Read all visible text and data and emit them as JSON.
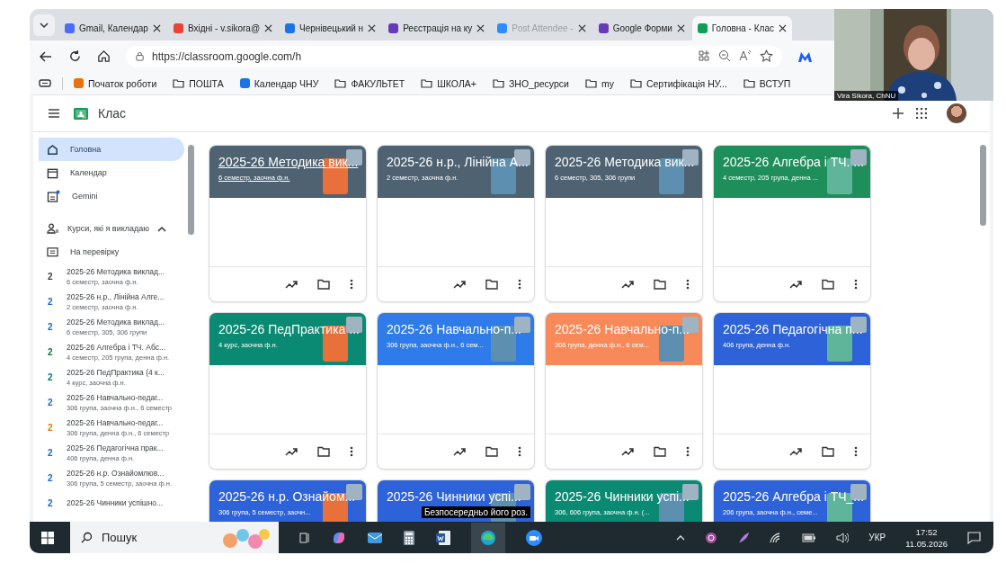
{
  "browser": {
    "tabs": [
      {
        "label": "Gmail, Календар",
        "color": "#4a6cf7",
        "selected": false,
        "disabled": false
      },
      {
        "label": "Вхідні - v.sikora@",
        "color": "#ea4335",
        "selected": false,
        "disabled": false
      },
      {
        "label": "Чернівецький н",
        "color": "#1a73e8",
        "selected": false,
        "disabled": false
      },
      {
        "label": "Реєстрація на ку",
        "color": "#673ab7",
        "selected": false,
        "disabled": false
      },
      {
        "label": "Post Attendee -",
        "color": "#2d8cff",
        "selected": false,
        "disabled": true
      },
      {
        "label": "Google Форми",
        "color": "#673ab7",
        "selected": false,
        "disabled": false
      },
      {
        "label": "Головна - Клас",
        "color": "#0f9d58",
        "selected": true,
        "disabled": false
      }
    ],
    "url": "https://classroom.google.com/h",
    "bookmarks": [
      {
        "label": "Початок роботи",
        "kind": "site",
        "color": "#e8710a"
      },
      {
        "label": "ПОШТА",
        "kind": "folder"
      },
      {
        "label": "Календар ЧНУ",
        "kind": "site",
        "color": "#1a73e8"
      },
      {
        "label": "ФАКУЛЬТЕТ",
        "kind": "folder"
      },
      {
        "label": "ШКОЛА+",
        "kind": "folder"
      },
      {
        "label": "ЗНО_ресурси",
        "kind": "folder"
      },
      {
        "label": "my",
        "kind": "folder"
      },
      {
        "label": "Сертифікація НУ...",
        "kind": "folder"
      },
      {
        "label": "ВСТУП",
        "kind": "folder"
      }
    ]
  },
  "webcam": {
    "kind": "picture",
    "caption": "Vira Sikora, ChNU"
  },
  "app": {
    "title": "Клас",
    "nav": [
      {
        "label": "Головна",
        "kind": "home",
        "selected": true
      },
      {
        "label": "Календар",
        "kind": "calendar",
        "selected": false
      },
      {
        "label": "Gemini",
        "kind": "gemini",
        "selected": false
      }
    ],
    "section": {
      "label": "Курси, які я викладаю",
      "expanded": true
    },
    "review": "На перевірку",
    "courses": [
      {
        "badge": "2",
        "color": "#3c4043",
        "title": "2025-26 Методика виклад...",
        "subtitle": "6 семестр, заочна ф.н."
      },
      {
        "badge": "2",
        "color": "#1967d2",
        "title": "2025-26 н.р., Лінійна Алге...",
        "subtitle": "2 семестр, заочна ф.н."
      },
      {
        "badge": "2",
        "color": "#1967d2",
        "title": "2025-26 Методика виклад...",
        "subtitle": "6 семестр, 305, 306 групи"
      },
      {
        "badge": "2",
        "color": "#137333",
        "title": "2025-26 Алгебра і ТЧ. Абс...",
        "subtitle": "4 семестр, 205 група, денна ф.н."
      },
      {
        "badge": "2",
        "color": "#00796b",
        "title": "2025-26 ПедПрактика (4 к...",
        "subtitle": "4 курс, заочна ф.н."
      },
      {
        "badge": "2",
        "color": "#1967d2",
        "title": "2025-26 Навчально-педаг...",
        "subtitle": "306 група, заочна ф.н., 6 семестр"
      },
      {
        "badge": "2",
        "color": "#e37400",
        "title": "2025-26 Навчально-педаг...",
        "subtitle": "306 група, денна ф.н., 6 семестр"
      },
      {
        "badge": "2",
        "color": "#1967d2",
        "title": "2025-26 Педагогічна прак...",
        "subtitle": "406 група, денна ф.н."
      },
      {
        "badge": "2",
        "color": "#1967d2",
        "title": "2025-26 н.р. Ознайомлюв...",
        "subtitle": "306 група, 5 семестр, заочна ф.н."
      },
      {
        "badge": "2",
        "color": "#1967d2",
        "title": "2025-26 Чинники успішно..."
      }
    ],
    "cards": [
      {
        "title": "2025-26 Методика вик...",
        "subtitle": "6 семестр, заочна ф.н.",
        "color": "#4f6272",
        "hovered": true
      },
      {
        "title": "2025-26 н.р., Лінійна А...",
        "subtitle": "2 семестр, заочна ф.н.",
        "color": "#4f6272",
        "hovered": false
      },
      {
        "title": "2025-26 Методика вик...",
        "subtitle": "6 семестр, 305, 306 групи",
        "color": "#4f6272",
        "hovered": false
      },
      {
        "title": "2025-26 Алгебра і ТЧ. ...",
        "subtitle": "4 семестр, 205 група, денна ...",
        "color": "#1e8e5a",
        "hovered": false
      },
      {
        "title": "2025-26 ПедПрактика ...",
        "subtitle": "4 курс, заочна ф.н.",
        "color": "#0b8a73",
        "hovered": false
      },
      {
        "title": "2025-26 Навчально-п...",
        "subtitle": "306 група, заочна ф.н., 6 сем...",
        "color": "#2f7bea",
        "hovered": false
      },
      {
        "title": "2025-26 Навчально-п...",
        "subtitle": "306 група, денна ф.н., 6 сем...",
        "color": "#f88a5a",
        "hovered": false
      },
      {
        "title": "2025-26 Педагогічна п...",
        "subtitle": "406 група, денна ф.н.",
        "color": "#2e62d9",
        "hovered": false
      }
    ],
    "cards_cut_off": [
      {
        "title": "2025-26 н.р. Ознайом...",
        "subtitle": "306 група, 5 семестр, заочн...",
        "color": "#2e62d9"
      },
      {
        "title": "2025-26 Чинники успі...",
        "color": "#2e62d9"
      },
      {
        "title": "2025-26 Чинники успі...",
        "subtitle": "306, 606 група, заочна ф.н. (...",
        "color": "#0b8a73"
      },
      {
        "title": "2025-26 Алгебра і ТЧ_...",
        "subtitle": "206 група, заочна ф.н., семе...",
        "color": "#2e62d9"
      }
    ]
  },
  "video_caption": "Безпосередньо його роз.",
  "taskbar": {
    "search": "Пошук",
    "language": "УКР",
    "time": "17:52",
    "date": "11.05.2026"
  }
}
